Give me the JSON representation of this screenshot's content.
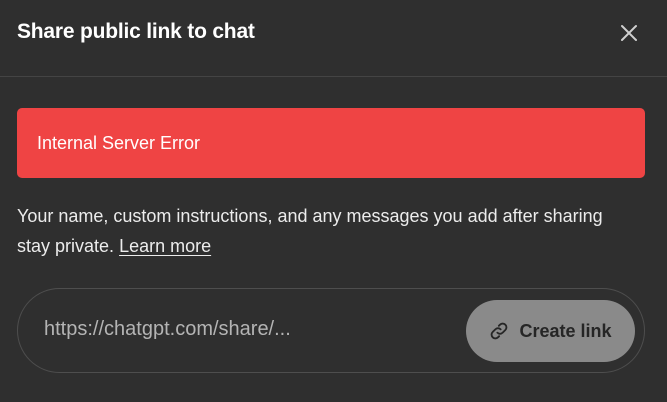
{
  "dialog": {
    "title": "Share public link to chat",
    "close_icon": "close-icon"
  },
  "error": {
    "message": "Internal Server Error",
    "color": "#ef4444"
  },
  "info": {
    "text": "Your name, custom instructions, and any messages you add after sharing stay private.",
    "learn_more": "Learn more"
  },
  "share": {
    "url": "https://chatgpt.com/share/...",
    "button_label": "Create link",
    "button_icon": "link-icon"
  }
}
